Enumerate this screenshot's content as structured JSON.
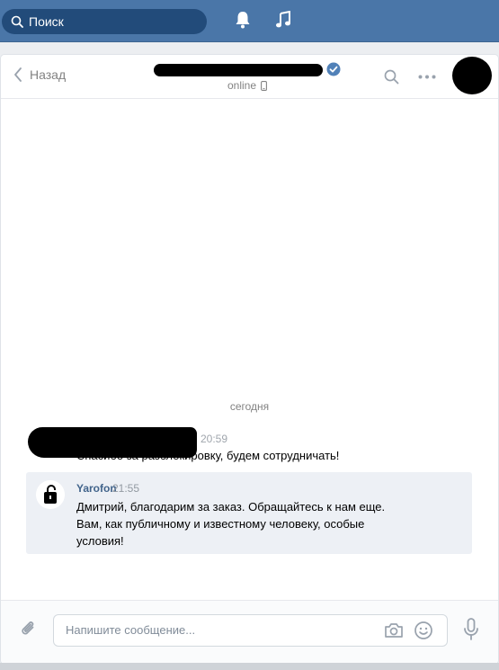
{
  "topbar": {
    "search_placeholder": "Поиск",
    "icons": [
      "search-icon",
      "bell-icon",
      "music-icon"
    ]
  },
  "header": {
    "back_label": "Назад",
    "status": "online",
    "icons": [
      "back-chevron-icon",
      "verified-icon",
      "mobile-icon",
      "search-icon",
      "more-icon"
    ]
  },
  "chat": {
    "date_separator": "сегодня",
    "messages": [
      {
        "time": "20:59",
        "text": "Спасибо за разблокировку, будем сотрудничать!"
      },
      {
        "author": "Yarofon",
        "time": "21:55",
        "lines": [
          "Дмитрий, благодарим за заказ. Обращайтесь к нам еще.",
          "Вам, как публичному и известному человеку, особые",
          "условия!"
        ]
      }
    ]
  },
  "composer": {
    "placeholder": "Напишите сообщение...",
    "icons": [
      "attach-icon",
      "camera-icon",
      "emoji-icon",
      "mic-icon"
    ]
  },
  "colors": {
    "topbar": "#4a76a8",
    "search_field": "#224b7a",
    "author_link": "#42648b",
    "selected_message": "#edf0f5",
    "verified": "#5181b8"
  }
}
